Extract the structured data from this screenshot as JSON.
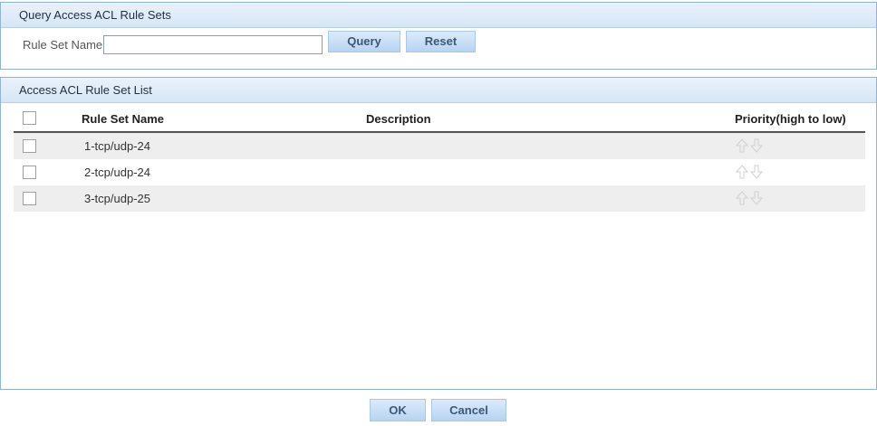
{
  "query_panel": {
    "title": "Query Access ACL Rule Sets",
    "rule_set_name_label": "Rule Set Name",
    "rule_set_name_value": "",
    "query_label": "Query",
    "reset_label": "Reset"
  },
  "list_panel": {
    "title": "Access ACL Rule Set List",
    "columns": {
      "name": "Rule Set Name",
      "description": "Description",
      "priority": "Priority(high to low)"
    },
    "rows": [
      {
        "name": "1-tcp/udp-24",
        "description": "",
        "checked": false
      },
      {
        "name": "2-tcp/udp-24",
        "description": "",
        "checked": false
      },
      {
        "name": "3-tcp/udp-25",
        "description": "",
        "checked": false
      }
    ]
  },
  "footer": {
    "ok_label": "OK",
    "cancel_label": "Cancel"
  },
  "icons": {
    "priority_up": "arrow-up-icon",
    "priority_down": "arrow-down-icon"
  },
  "colors": {
    "panel_border": "#8eb4d8",
    "button_fill": "#b7d3f2",
    "row_alt": "#eeeeee"
  }
}
